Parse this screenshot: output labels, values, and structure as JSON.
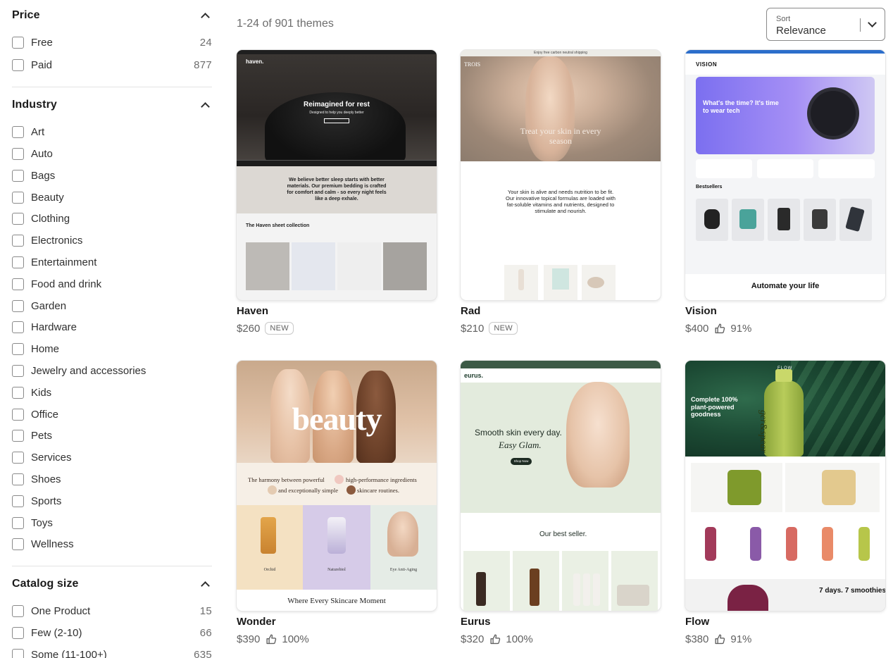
{
  "filters": {
    "price": {
      "title": "Price",
      "options": [
        {
          "label": "Free",
          "count": "24"
        },
        {
          "label": "Paid",
          "count": "877"
        }
      ]
    },
    "industry": {
      "title": "Industry",
      "options": [
        {
          "label": "Art"
        },
        {
          "label": "Auto"
        },
        {
          "label": "Bags"
        },
        {
          "label": "Beauty"
        },
        {
          "label": "Clothing"
        },
        {
          "label": "Electronics"
        },
        {
          "label": "Entertainment"
        },
        {
          "label": "Food and drink"
        },
        {
          "label": "Garden"
        },
        {
          "label": "Hardware"
        },
        {
          "label": "Home"
        },
        {
          "label": "Jewelry and accessories"
        },
        {
          "label": "Kids"
        },
        {
          "label": "Office"
        },
        {
          "label": "Pets"
        },
        {
          "label": "Services"
        },
        {
          "label": "Shoes"
        },
        {
          "label": "Sports"
        },
        {
          "label": "Toys"
        },
        {
          "label": "Wellness"
        }
      ]
    },
    "catalog_size": {
      "title": "Catalog size",
      "options": [
        {
          "label": "One Product",
          "count": "15"
        },
        {
          "label": "Few (2-10)",
          "count": "66"
        },
        {
          "label": "Some (11-100+)",
          "count": "635"
        }
      ]
    }
  },
  "results": {
    "count_text": "1-24 of 901 themes"
  },
  "sort": {
    "label": "Sort",
    "value": "Relevance"
  },
  "themes": [
    {
      "name": "Haven",
      "price": "$260",
      "badge": "NEW",
      "preview": {
        "logo": "haven.",
        "headline": "Reimagined for rest",
        "sub": "Designed to help you deeply better",
        "body": "We believe better sleep starts with better materials. Our premium bedding is crafted for comfort and calm - so every night feels like a deep exhale.",
        "section": "The Haven sheet collection"
      }
    },
    {
      "name": "Rad",
      "price": "$210",
      "badge": "NEW",
      "preview": {
        "banner": "Enjoy free carbon neutral shipping",
        "logo": "TROIS",
        "headline": "Treat your skin in every season",
        "body": "Your skin is alive and needs nutrition to be fit. Our innovative topical formulas are loaded with fat-soluble vitamins and nutrients, designed to stimulate and nourish."
      }
    },
    {
      "name": "Vision",
      "price": "$400",
      "rating": "91%",
      "preview": {
        "logo": "VISION",
        "headline": "What's the time? It's time to wear tech",
        "section": "Bestsellers",
        "footer": "Automate your life"
      }
    },
    {
      "name": "Wonder",
      "price": "$390",
      "rating": "100%",
      "preview": {
        "headline": "beauty",
        "tagline1": "The harmony between powerful",
        "tagline1b": "high-performance ingredients",
        "tagline2": "and exceptionally simple",
        "tagline2b": "skincare routines.",
        "p1": "Orchid",
        "p2": "Naturebiol",
        "p3": "Eye Anti-Aging",
        "footer": "Where Every Skincare Moment"
      }
    },
    {
      "name": "Eurus",
      "price": "$320",
      "rating": "100%",
      "preview": {
        "logo": "eurus.",
        "headline": "Smooth skin every day.",
        "sub": "Easy Glam.",
        "cta": "Shop Now",
        "section": "Our best seller.",
        "section_em": "best seller."
      }
    },
    {
      "name": "Flow",
      "price": "$380",
      "rating": "91%",
      "preview": {
        "logo": "FLOW",
        "headline": "Complete 100% plant-powered goodness",
        "bottle": "ger&spear",
        "footer": "7 days. 7 smoothies."
      }
    }
  ],
  "colors": {
    "accent_blue": "#2c6ecb",
    "text": "#303030",
    "muted": "#6d6d6d"
  },
  "icons": {
    "collapse": "chevron-up-icon",
    "sort": "chevron-down-icon",
    "rating": "thumbs-up-icon"
  }
}
